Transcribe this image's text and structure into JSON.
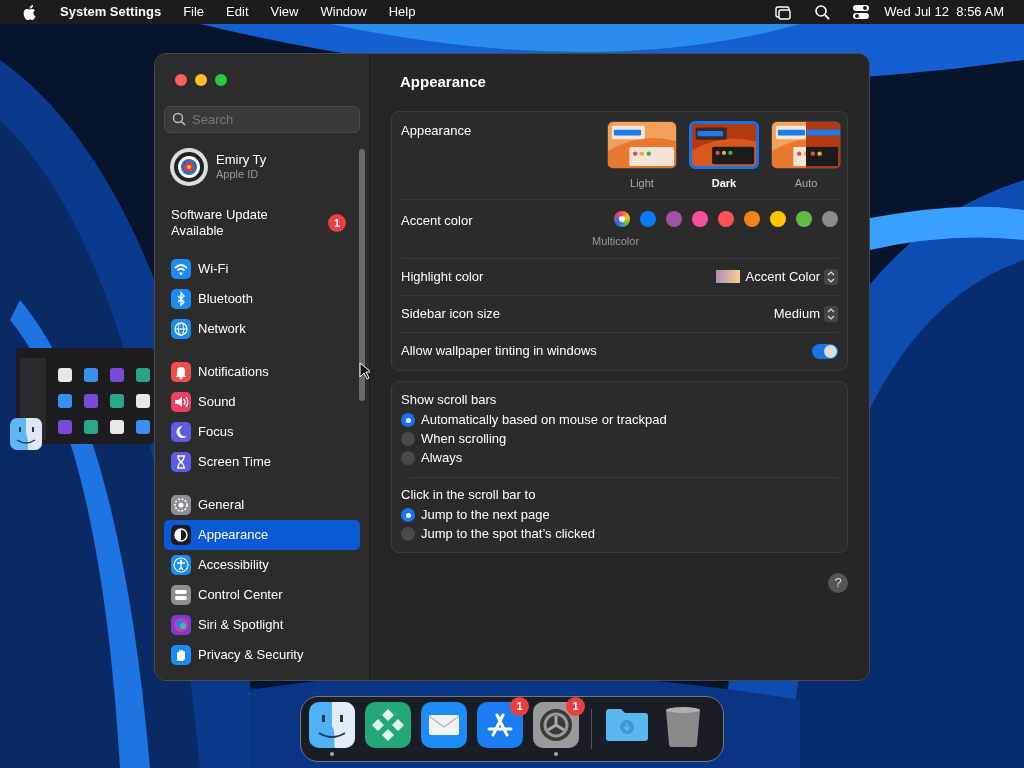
{
  "menu_bar": {
    "app_name": "System Settings",
    "items": [
      "File",
      "Edit",
      "View",
      "Window",
      "Help"
    ],
    "clock": "Wed Jul 12  8:56 AM"
  },
  "sidebar": {
    "search": {
      "placeholder": "Search"
    },
    "account": {
      "name": "Emiry Ty",
      "subtitle": "Apple ID"
    },
    "update": {
      "label": "Software Update Available",
      "badge": "1"
    },
    "groups": [
      [
        {
          "label": "Wi-Fi",
          "kind": "wifi",
          "selected": false
        },
        {
          "label": "Bluetooth",
          "kind": "bluetooth",
          "selected": false
        },
        {
          "label": "Network",
          "kind": "network",
          "selected": false
        }
      ],
      [
        {
          "label": "Notifications",
          "kind": "notifications",
          "selected": false
        },
        {
          "label": "Sound",
          "kind": "sound",
          "selected": false
        },
        {
          "label": "Focus",
          "kind": "focus",
          "selected": false
        },
        {
          "label": "Screen Time",
          "kind": "screentime",
          "selected": false
        }
      ],
      [
        {
          "label": "General",
          "kind": "general",
          "selected": false
        },
        {
          "label": "Appearance",
          "kind": "appearance",
          "selected": true
        },
        {
          "label": "Accessibility",
          "kind": "accessibility",
          "selected": false
        },
        {
          "label": "Control Center",
          "kind": "controlcenter",
          "selected": false
        },
        {
          "label": "Siri & Spotlight",
          "kind": "siri",
          "selected": false
        },
        {
          "label": "Privacy & Security",
          "kind": "privacy",
          "selected": false
        }
      ]
    ]
  },
  "content": {
    "title": "Appearance",
    "appearance": {
      "label": "Appearance",
      "options": [
        {
          "label": "Light",
          "kind": "light",
          "selected": false
        },
        {
          "label": "Dark",
          "kind": "dark",
          "selected": true
        },
        {
          "label": "Auto",
          "kind": "auto",
          "selected": false
        }
      ]
    },
    "accent": {
      "label": "Accent color",
      "caption": "Multicolor",
      "colors": [
        {
          "kind": "multicolor",
          "selected": true
        },
        {
          "kind": "solid",
          "color": "#0a7aff",
          "selected": false
        },
        {
          "kind": "solid",
          "color": "#a550a7",
          "selected": false
        },
        {
          "kind": "solid",
          "color": "#f74f9e",
          "selected": false
        },
        {
          "kind": "solid",
          "color": "#ff5257",
          "selected": false
        },
        {
          "kind": "solid",
          "color": "#f7821b",
          "selected": false
        },
        {
          "kind": "solid",
          "color": "#ffc600",
          "selected": false
        },
        {
          "kind": "solid",
          "color": "#62ba46",
          "selected": false
        },
        {
          "kind": "solid",
          "color": "#8c8c8c",
          "selected": false
        }
      ]
    },
    "highlight": {
      "label": "Highlight color",
      "value": "Accent Color"
    },
    "icon_size": {
      "label": "Sidebar icon size",
      "value": "Medium"
    },
    "tinting": {
      "label": "Allow wallpaper tinting in windows",
      "on": true
    },
    "scroll_bars": {
      "label": "Show scroll bars",
      "options": [
        {
          "label": "Automatically based on mouse or trackpad",
          "selected": true
        },
        {
          "label": "When scrolling",
          "selected": false
        },
        {
          "label": "Always",
          "selected": false
        }
      ]
    },
    "click": {
      "label": "Click in the scroll bar to",
      "options": [
        {
          "label": "Jump to the next page",
          "selected": true
        },
        {
          "label": "Jump to the spot that’s clicked",
          "selected": false
        }
      ]
    },
    "help_button": "?"
  },
  "dock": {
    "items": [
      {
        "kind": "finder",
        "running": true
      },
      {
        "kind": "tiles",
        "running": false
      },
      {
        "kind": "mail",
        "running": false
      },
      {
        "kind": "appstore",
        "running": false,
        "badge": "1"
      },
      {
        "kind": "settings",
        "running": true,
        "badge": "1"
      },
      {
        "kind": "folder",
        "running": false
      },
      {
        "kind": "trash",
        "running": false
      }
    ]
  }
}
